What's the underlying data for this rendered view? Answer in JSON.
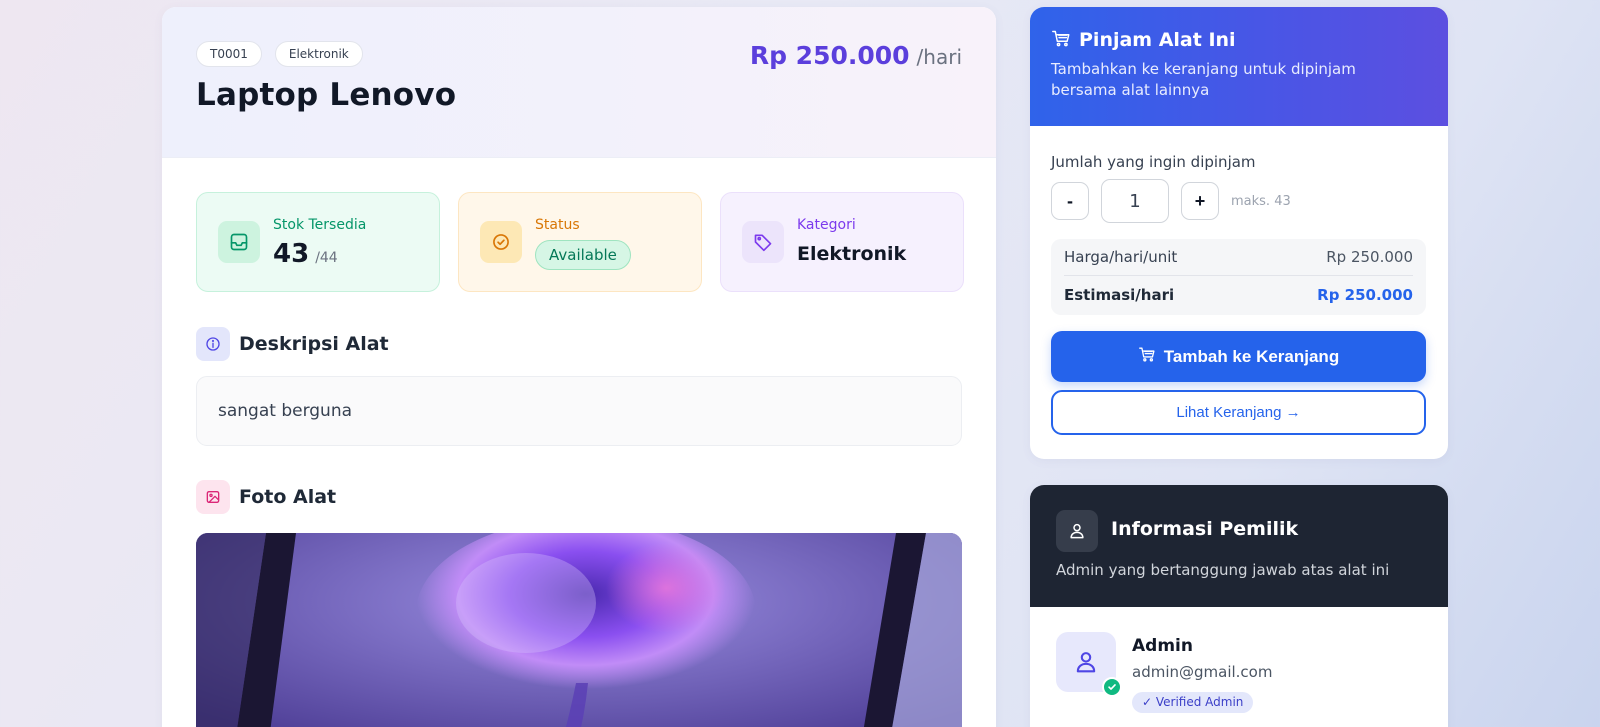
{
  "detail": {
    "tags": [
      "T0001",
      "Elektronik"
    ],
    "title": "Laptop Lenovo",
    "price": "Rp 250.000",
    "price_unit": "/hari"
  },
  "stats": {
    "stok": {
      "label": "Stok Tersedia",
      "value": "43",
      "total": "/44"
    },
    "status": {
      "label": "Status",
      "value": "Available"
    },
    "kategori": {
      "label": "Kategori",
      "value": "Elektronik"
    }
  },
  "deskripsi": {
    "title": "Deskripsi Alat",
    "text": "sangat berguna"
  },
  "foto": {
    "title": "Foto Alat"
  },
  "pinjam": {
    "title": "Pinjam Alat Ini",
    "subtitle": "Tambahkan ke keranjang untuk dipinjam bersama alat lainnya",
    "qty_label": "Jumlah yang ingin dipinjam",
    "minus": "-",
    "plus": "+",
    "qty_value": "1",
    "qty_max": "maks. 43",
    "harga_label": "Harga/hari/unit",
    "harga_value": "Rp 250.000",
    "estimasi_label": "Estimasi/hari",
    "estimasi_value": "Rp 250.000",
    "add_button": "Tambah ke Keranjang",
    "view_cart": "Lihat Keranjang →"
  },
  "owner": {
    "title": "Informasi Pemilik",
    "subtitle": "Admin yang bertanggung jawab atas alat ini",
    "name": "Admin",
    "email": "admin@gmail.com",
    "badge": "✓ Verified Admin"
  },
  "colors": {
    "accent": "#5b3fdc",
    "primary_blue": "#2563eb",
    "green": "#059669",
    "orange": "#d97706",
    "purple": "#7c3aed",
    "dark": "#1e2533"
  },
  "icons": {
    "stok": "inbox-icon",
    "status": "check-circle-icon",
    "kategori": "tag-icon",
    "deskripsi": "info-icon",
    "foto": "image-icon",
    "pinjam": "cart-icon",
    "owner": "user-icon"
  }
}
